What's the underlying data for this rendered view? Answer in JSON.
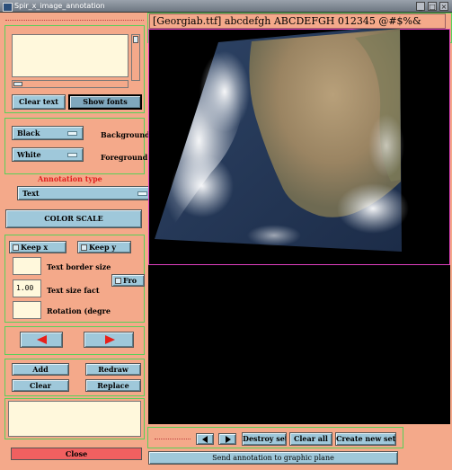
{
  "window": {
    "title": "Spir_x_image_annotation",
    "minimize_glyph": "_",
    "maximize_glyph": "□",
    "close_glyph": "×"
  },
  "font_panel": {
    "clear_text_label": "Clear text",
    "show_fonts_label": "Show fonts",
    "text_value": ""
  },
  "colors_panel": {
    "background_color": "Black",
    "background_label": "Background",
    "foreground_color": "White",
    "foreground_label": "Foreground",
    "annotation_type_label": "Annotation type",
    "annotation_type_value": "Text",
    "color_scale_label": "COLOR SCALE"
  },
  "options_panel": {
    "keep_x_label": "Keep x",
    "keep_y_label": "Keep y",
    "text_border_size_label": "Text border size",
    "text_border_size_value": "",
    "text_size_factor_label": "Text size fact",
    "text_size_factor_value": "1.00",
    "fro_label": "Fro",
    "rotation_label": "Rotation (degre",
    "rotation_value": ""
  },
  "actions": {
    "add_label": "Add",
    "redraw_label": "Redraw",
    "clear_label": "Clear",
    "replace_label": "Replace",
    "notes_value": "",
    "close_label": "Close"
  },
  "preview": {
    "font_sample": "[Georgiab.ttf] abcdefgh ABCDEFGH 012345 @#$%&"
  },
  "bottom_bar": {
    "destroy_set_label": "Destroy set",
    "clear_all_label": "Clear all",
    "create_new_set_label": "Create new set",
    "send_label": "Send annotation to graphic plane"
  },
  "colors": {
    "panel_bg": "#f4a98a",
    "button_bg": "#9fc8da",
    "arrow_red": "#e8201a",
    "frame_green": "#58d058",
    "frame_magenta": "#e040c0",
    "close_button": "#f06060"
  }
}
